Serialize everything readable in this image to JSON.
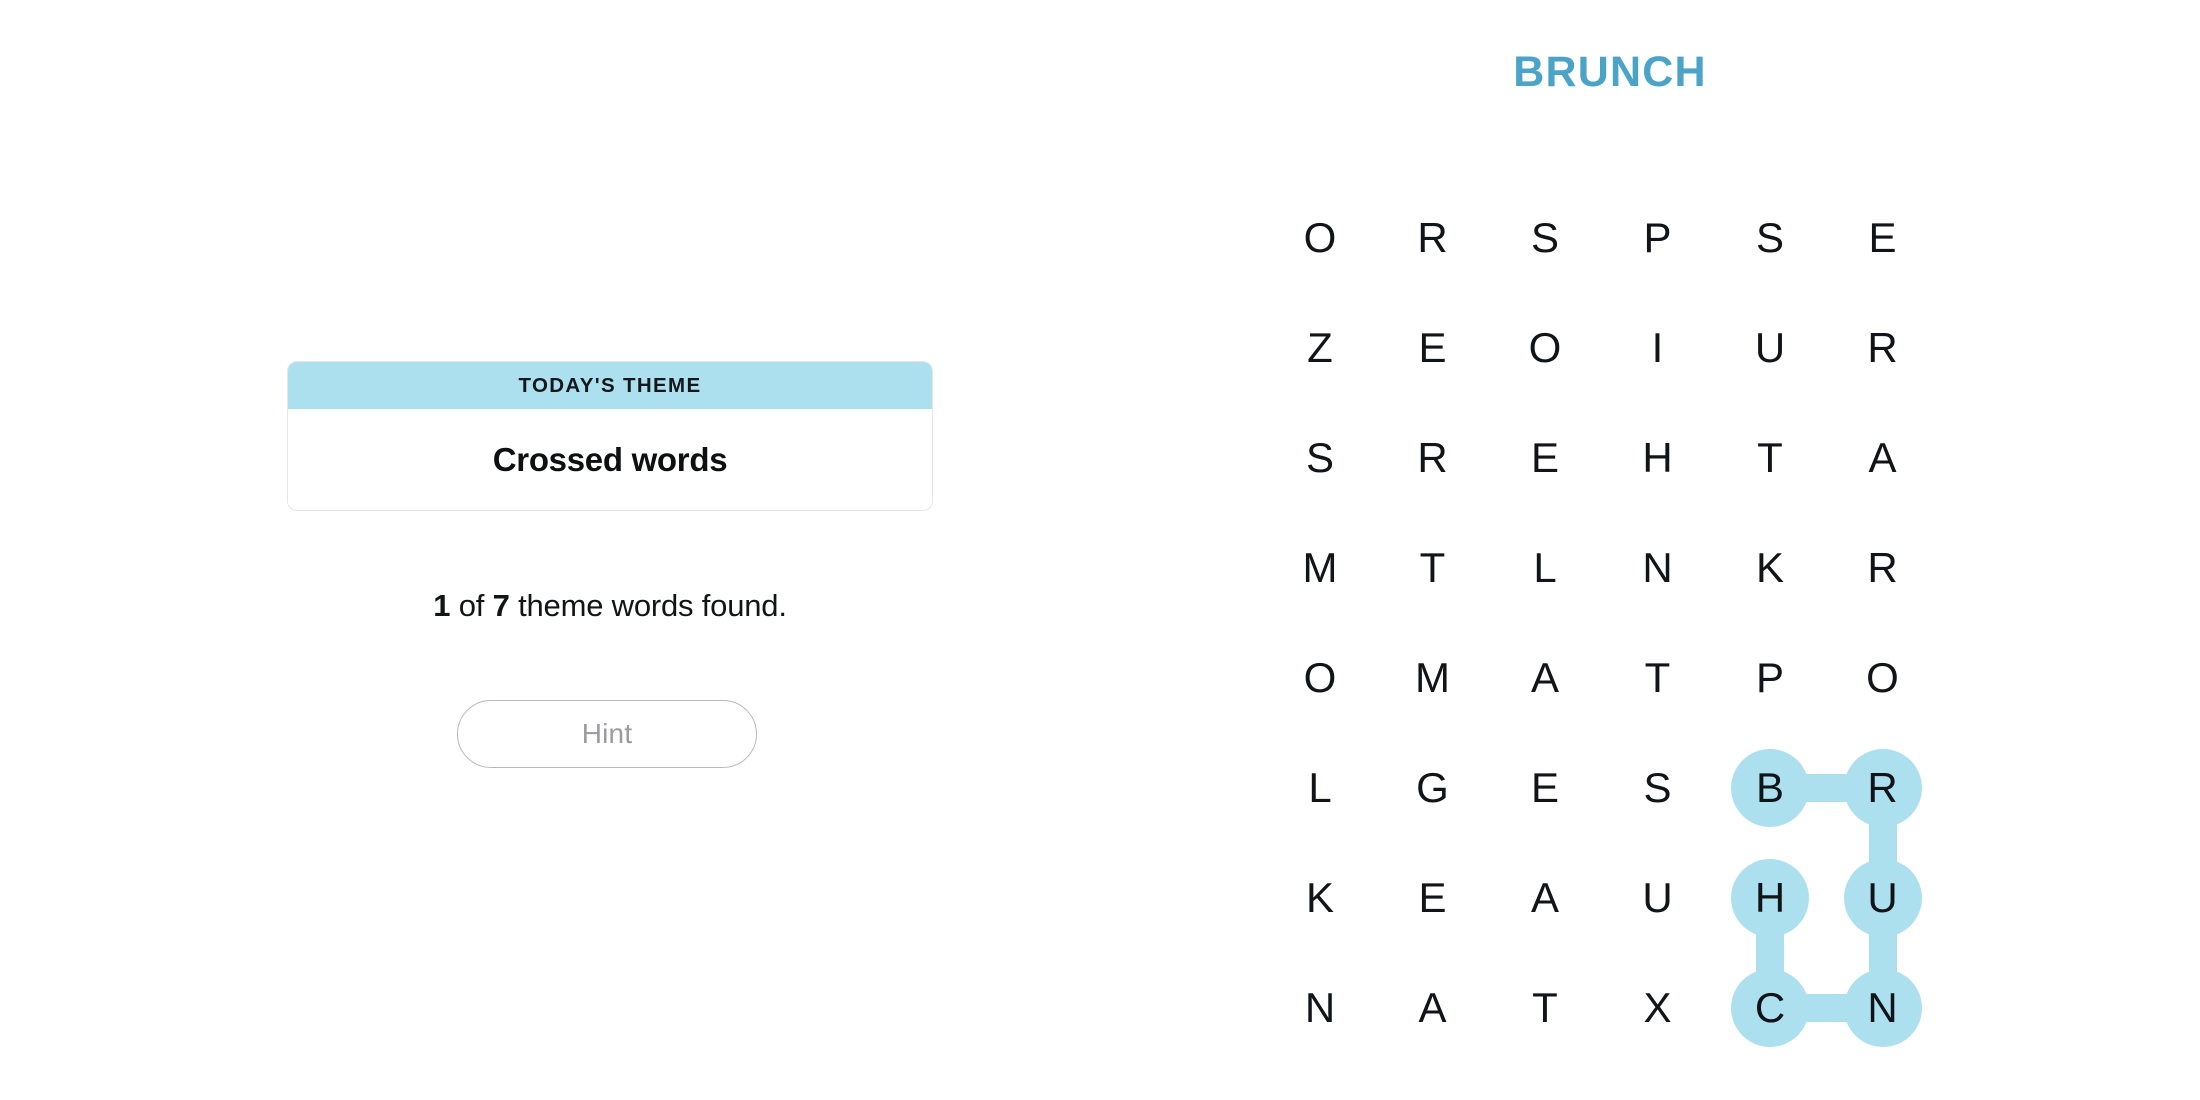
{
  "puzzle": {
    "title": "BRUNCH",
    "title_color": "#4ba4c8",
    "highlight_color": "#ade0ee"
  },
  "theme_card": {
    "header_label": "TODAY'S THEME",
    "theme_value": "Crossed words",
    "header_bg": "#ade0ee"
  },
  "progress": {
    "found": "1",
    "connector_of": "of",
    "total": "7",
    "suffix": "theme words found."
  },
  "hint_button": {
    "label": "Hint"
  },
  "grid": {
    "rows": 8,
    "cols": 6,
    "letters": [
      [
        "O",
        "R",
        "S",
        "P",
        "S",
        "E"
      ],
      [
        "Z",
        "E",
        "O",
        "I",
        "U",
        "R"
      ],
      [
        "S",
        "R",
        "E",
        "H",
        "T",
        "A"
      ],
      [
        "M",
        "T",
        "L",
        "N",
        "K",
        "R"
      ],
      [
        "O",
        "M",
        "A",
        "T",
        "P",
        "O"
      ],
      [
        "L",
        "G",
        "E",
        "S",
        "B",
        "R"
      ],
      [
        "K",
        "E",
        "A",
        "U",
        "H",
        "U"
      ],
      [
        "N",
        "A",
        "T",
        "X",
        "C",
        "N"
      ]
    ],
    "found_word": "BRUNCH",
    "found_path": [
      {
        "row": 5,
        "col": 4,
        "letter": "B"
      },
      {
        "row": 5,
        "col": 5,
        "letter": "R"
      },
      {
        "row": 6,
        "col": 5,
        "letter": "U"
      },
      {
        "row": 7,
        "col": 5,
        "letter": "N"
      },
      {
        "row": 7,
        "col": 4,
        "letter": "C"
      },
      {
        "row": 6,
        "col": 4,
        "letter": "H"
      }
    ]
  }
}
